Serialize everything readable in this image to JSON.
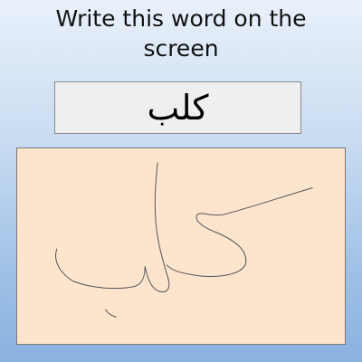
{
  "instruction": "Write this word on the screen",
  "target_word": "كلب",
  "drawing_canvas": {
    "background_color": "#fce4cd",
    "stroke_color": "#555555"
  }
}
